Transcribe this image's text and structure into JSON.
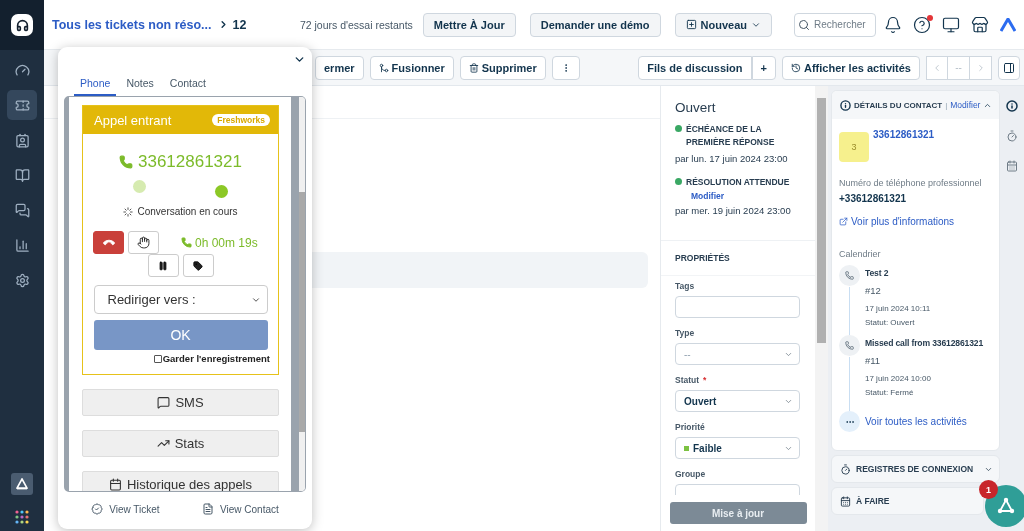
{
  "sidebar": {
    "items": [
      {
        "selected": false
      },
      {
        "selected": true
      },
      {
        "selected": false
      },
      {
        "selected": false
      },
      {
        "selected": false
      },
      {
        "selected": false
      },
      {
        "selected": false
      }
    ]
  },
  "topbar": {
    "breadcrumb": {
      "link": "Tous les tickets non réso...",
      "current": "12"
    },
    "trial": "72 jours d'essai restants",
    "buttons": [
      "Mettre À Jour",
      "Demander une démo"
    ],
    "new_button": "Nouveau",
    "search": {
      "placeholder": "Rechercher"
    },
    "help": {
      "notification": true
    }
  },
  "toolbar": {
    "actions": [
      {
        "label": "ermer",
        "kind": "plain"
      },
      {
        "label": "Fusionner",
        "kind": "merge"
      },
      {
        "label": "Supprimer",
        "kind": "delete"
      }
    ],
    "threads_button": "Fils de discussion",
    "add_button": "+",
    "activities_button": "Afficher les activités",
    "pager": {
      "current": "--",
      "disabled": true
    }
  },
  "properties_panel": {
    "status": "Ouvert",
    "sla": [
      {
        "title": "ÉCHÉANCE DE LA PREMIÈRE RÉPONSE",
        "due": "par lun. 17 juin 2024 23:00"
      },
      {
        "title": "RÉSOLUTION ATTENDUE",
        "link": "Modifier",
        "due": "par mer. 19 juin 2024 23:00"
      }
    ],
    "heading": "PROPRIÉTÉS",
    "fields": [
      {
        "label": "Tags",
        "kind": "input"
      },
      {
        "label": "Type",
        "kind": "select",
        "placeholder": "--"
      },
      {
        "label": "Statut",
        "required_mark": "*",
        "kind": "select",
        "value": "Ouvert"
      },
      {
        "label": "Priorité",
        "kind": "select",
        "value": "Faible",
        "color": "#7cc242"
      },
      {
        "label": "Groupe",
        "kind": "input"
      }
    ],
    "update_button": "Mise à jour"
  },
  "contact_panel": {
    "title": "DÉTAILS DU CONTACT",
    "edit_separator": "|",
    "edit_link": "Modifier",
    "expanded": true,
    "avatar": "3",
    "name": "33612861321",
    "phone_label": "Numéro de téléphone professionnel",
    "phone": "+33612861321",
    "more_link": "Voir plus d'informations",
    "timeline_heading": "Calendrier",
    "timeline": [
      {
        "title": "Test 2",
        "ticket": "#12",
        "date": "17 juin 2024 10:11",
        "status": "Statut: Ouvert"
      },
      {
        "title": "Missed call from 33612861321",
        "ticket": "#11",
        "date": "17 juin 2024 10:00",
        "status": "Statut: Fermé"
      }
    ],
    "all_link": "Voir toutes les activités"
  },
  "sections": [
    {
      "title": "REGISTRES DE CONNEXION",
      "kind": "logs",
      "expanded": false
    },
    {
      "title": "À FAIRE",
      "kind": "todo"
    }
  ],
  "fab": {
    "badge": "1"
  },
  "phone_widget": {
    "tabs": [
      {
        "label": "Phone",
        "selected": true
      },
      {
        "label": "Notes",
        "selected": false
      },
      {
        "label": "Contact",
        "selected": false
      }
    ],
    "call": {
      "title": "Appel entrant",
      "brand": "Freshworks",
      "number": "33612861321",
      "indicators": [
        {
          "color": "#d6ebb0"
        },
        {
          "color": "#8cc826"
        }
      ],
      "status": "Conversation en cours",
      "timer": "0h 00m 19s"
    },
    "redirect": {
      "placeholder": "Rediriger vers :"
    },
    "ok_button": "OK",
    "keep_recording": {
      "label": "Garder l'enregistrement",
      "checked": false
    },
    "menu": [
      {
        "label": "SMS",
        "kind": "sms"
      },
      {
        "label": "Stats",
        "kind": "stats"
      },
      {
        "label": "Historique des appels",
        "kind": "history"
      }
    ],
    "footer": [
      {
        "label": "View Ticket",
        "kind": "ticket"
      },
      {
        "label": "View Contact",
        "kind": "contact"
      }
    ]
  }
}
